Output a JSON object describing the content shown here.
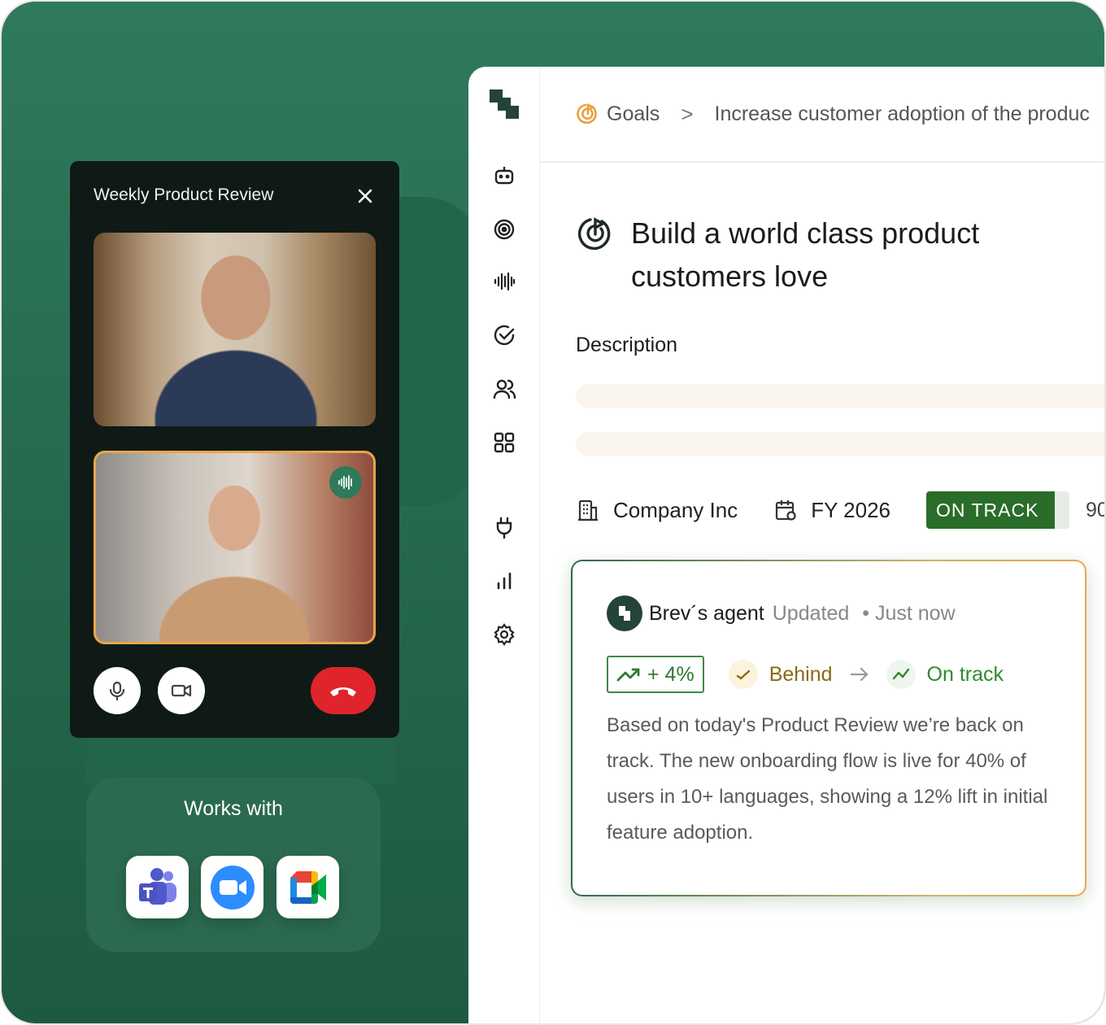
{
  "breadcrumb": {
    "root": "Goals",
    "separator": ">",
    "current": "Increase customer adoption of the produc"
  },
  "goal": {
    "title_line1": "Build a world class product",
    "title_line2": "customers love",
    "description_label": "Description"
  },
  "meta": {
    "company": "Company Inc",
    "fiscal_year": "FY 2026",
    "status": "ON TRACK",
    "status_progress": 0.9,
    "percent_partial": "90"
  },
  "update_card": {
    "author": "Brev´s agent",
    "action": "Updated",
    "time": "• Just now",
    "delta": "+ 4%",
    "from_status": "Behind",
    "to_status": "On track",
    "body": "Based on today's Product Review we’re back on track. The new onboarding flow is live for 40% of users in 10+ languages, showing a 12% lift in initial feature adoption."
  },
  "call": {
    "title": "Weekly Product Review"
  },
  "works_with": {
    "title": "Works with",
    "apps": [
      "teams-icon",
      "zoom-icon",
      "google-meet-icon"
    ]
  },
  "colors": {
    "brand_green": "#2f7a5c",
    "status_green": "#2a6d2a",
    "hangup_red": "#e0242b",
    "accent_orange": "#e8a64a"
  }
}
